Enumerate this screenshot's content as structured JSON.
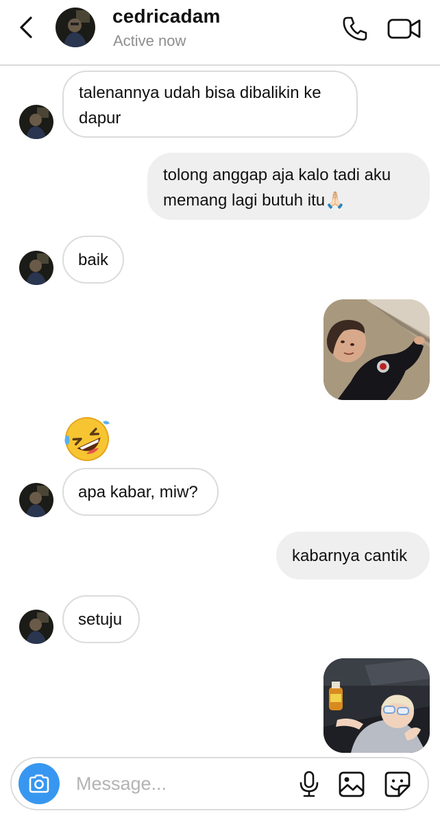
{
  "header": {
    "username": "cedricadam",
    "status": "Active now",
    "icons": {
      "back": "chevron-left-icon",
      "call": "phone-icon",
      "video": "video-camera-icon"
    }
  },
  "messages": [
    {
      "direction": "in",
      "type": "text",
      "lines": [
        "talenannya udah bisa dibalikin ke",
        "dapur"
      ]
    },
    {
      "direction": "out",
      "type": "text",
      "lines": [
        "tolong anggap aja kalo tadi aku",
        "memang lagi butuh itu🙏🏻"
      ]
    },
    {
      "direction": "in",
      "type": "text",
      "lines": [
        "baik"
      ]
    },
    {
      "direction": "out",
      "type": "image",
      "subject": "child-lying-on-floor-photo"
    },
    {
      "direction": "in",
      "type": "emoji",
      "emoji": "rolling-on-floor-laughing"
    },
    {
      "direction": "in",
      "type": "text",
      "lines": [
        "apa kabar, miw?"
      ]
    },
    {
      "direction": "out",
      "type": "text",
      "lines": [
        "kabarnya cantik"
      ]
    },
    {
      "direction": "in",
      "type": "text",
      "lines": [
        "setuju"
      ]
    },
    {
      "direction": "out",
      "type": "image",
      "subject": "toddler-with-sunglasses-photo"
    }
  ],
  "composer": {
    "placeholder": "Message...",
    "value": "",
    "icons": {
      "camera": "camera-icon",
      "mic": "microphone-icon",
      "gallery": "image-gallery-icon",
      "sticker": "sticker-icon"
    }
  },
  "colors": {
    "accent": "#3797f0",
    "incoming_border": "#dbdbdb",
    "outgoing_bg": "#efefef",
    "secondary_text": "#8e8e8e"
  }
}
